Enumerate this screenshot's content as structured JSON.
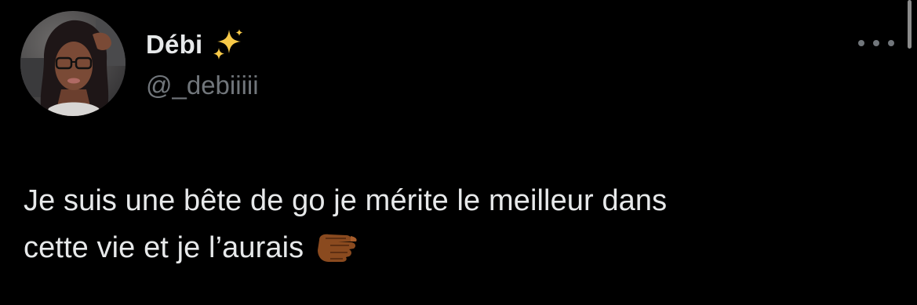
{
  "author": {
    "display_name": "Débi",
    "display_name_emoji": "sparkles-emoji",
    "handle": "@_debiiiii",
    "avatar": "profile-photo"
  },
  "menu": {
    "more_icon": "more-horizontal-icon"
  },
  "tweet": {
    "line1": "Je suis une bête de go je mérite le meilleur dans",
    "line2": "cette vie et je l’aurais",
    "trailing_emoji": "pointing-fist-emoji"
  },
  "colors": {
    "background": "#000000",
    "primary_text": "#e7e9ea",
    "secondary_text": "#71767b",
    "sparkle": "#f7c948"
  }
}
